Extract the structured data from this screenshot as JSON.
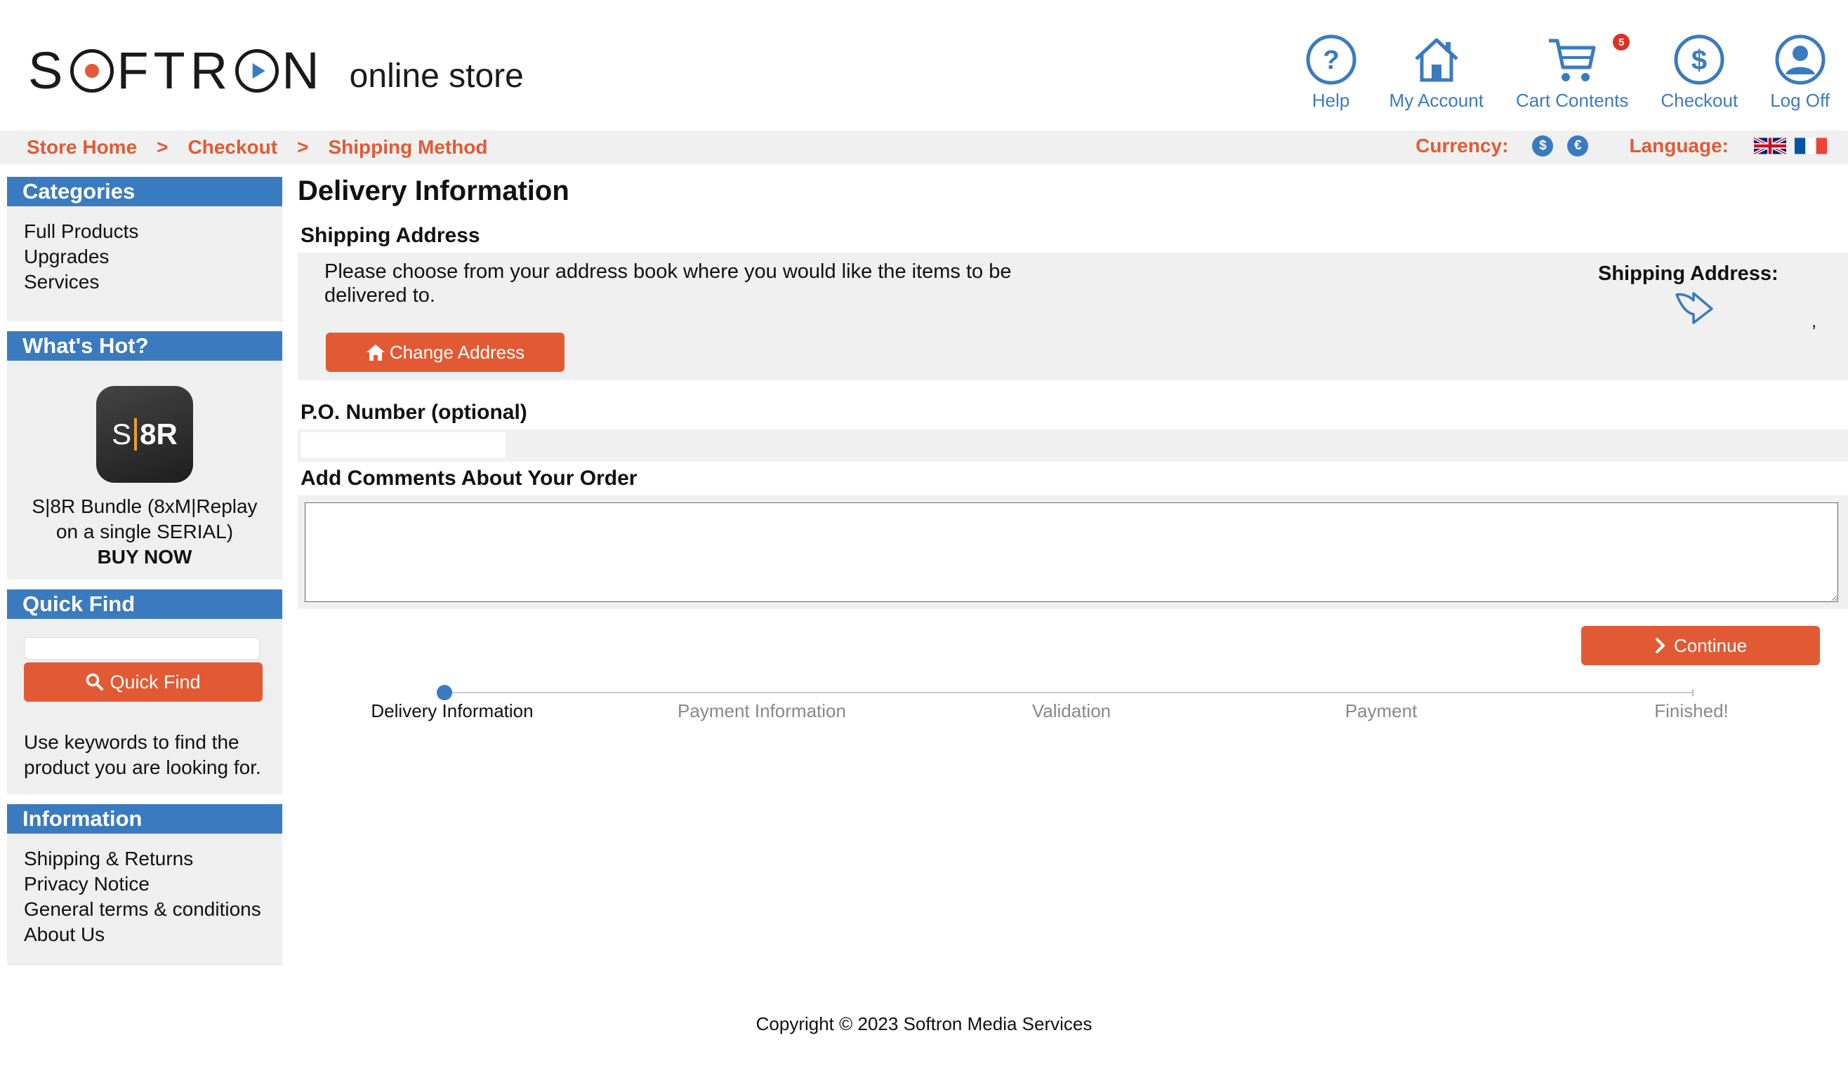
{
  "header": {
    "logo_text_before": "S",
    "logo_text_after": "FTR",
    "logo_text_end": "N",
    "logo_sub": "online store",
    "nav": [
      {
        "label": "Help",
        "icon": "help-icon"
      },
      {
        "label": "My Account",
        "icon": "home-icon"
      },
      {
        "label": "Cart Contents",
        "icon": "cart-icon",
        "badge": "5"
      },
      {
        "label": "Checkout",
        "icon": "dollar-icon"
      },
      {
        "label": "Log Off",
        "icon": "user-icon"
      }
    ]
  },
  "breadcrumb": {
    "items": [
      "Store Home",
      "Checkout",
      "Shipping Method"
    ],
    "separator": ">",
    "currency_label": "Currency:",
    "currencies": [
      "$",
      "€"
    ],
    "language_label": "Language:",
    "languages": [
      "english-flag",
      "french-flag"
    ]
  },
  "sidebar": {
    "categories": {
      "title": "Categories",
      "items": [
        "Full Products",
        "Upgrades",
        "Services"
      ]
    },
    "whats_hot": {
      "title": "What's Hot?",
      "icon_left": "S",
      "icon_right": "8R",
      "product_name": "S|8R Bundle (8xM|Replay on a single SERIAL)",
      "buy_now": "BUY NOW"
    },
    "quick_find": {
      "title": "Quick Find",
      "input_value": "",
      "button_label": "Quick Find",
      "help_text": "Use keywords to find the product you are looking for."
    },
    "information": {
      "title": "Information",
      "items": [
        "Shipping & Returns",
        "Privacy Notice",
        "General terms & conditions",
        "About Us"
      ]
    }
  },
  "main": {
    "title": "Delivery Information",
    "shipping_address_heading": "Shipping Address",
    "address_instructions": "Please choose from your address book where you would like the items to be delivered to.",
    "change_address_label": "Change Address",
    "shipping_address_label": "Shipping Address:",
    "shipping_address_value": ",",
    "po_heading": "P.O. Number (optional)",
    "po_value": "",
    "comments_heading": "Add Comments About Your Order",
    "comments_value": "",
    "continue_label": "Continue"
  },
  "progress": {
    "steps": [
      "Delivery Information",
      "Payment Information",
      "Validation",
      "Payment",
      "Finished!"
    ],
    "current_step": 0
  },
  "footer": {
    "copyright": "Copyright © 2023 Softron Media Services"
  },
  "colors": {
    "brand_blue": "#3a7bbf",
    "accent_orange": "#e25a34",
    "panel_gray": "#f0f0f0",
    "badge_red": "#e03025"
  }
}
